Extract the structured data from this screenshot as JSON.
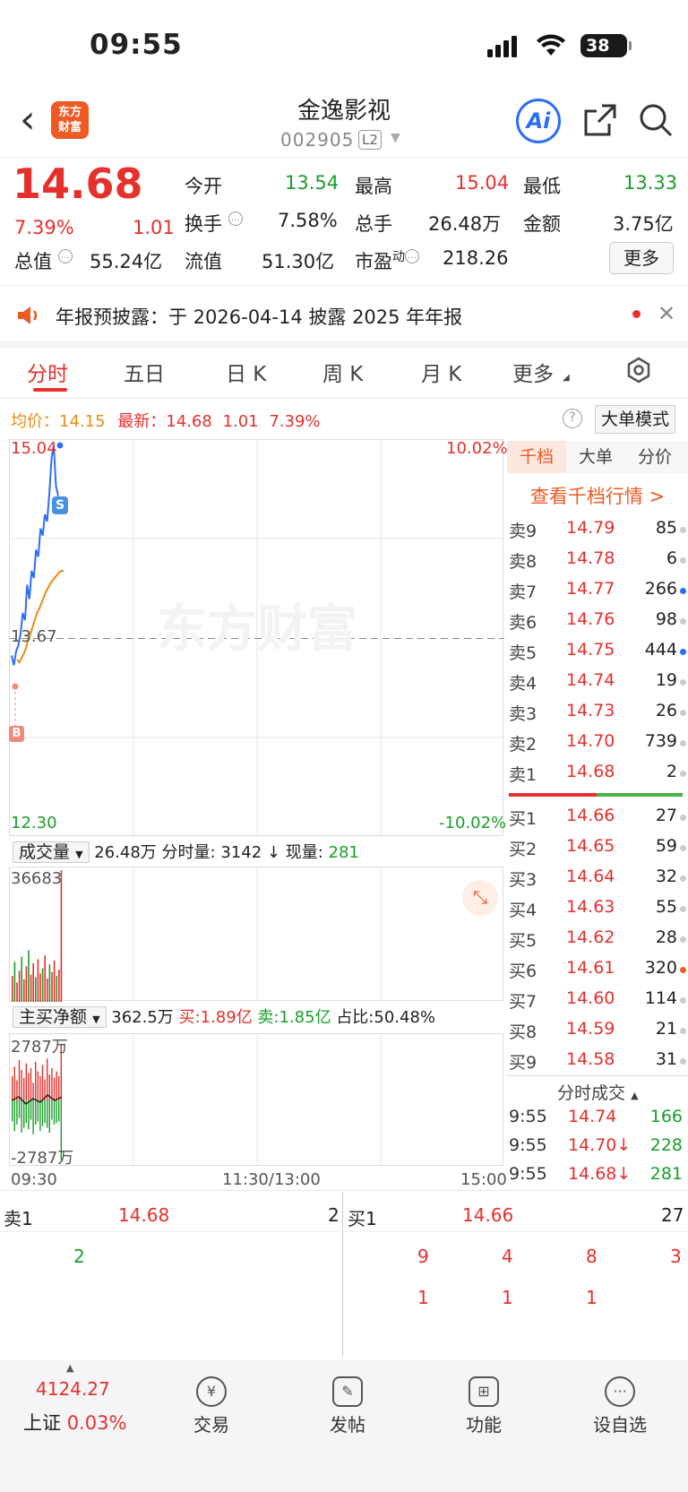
{
  "status_bar": {
    "time": "09:55",
    "battery": "38"
  },
  "header": {
    "logo_text": "东方财富",
    "stock_name": "金逸影视",
    "stock_code": "002905",
    "level": "L2",
    "ai_label": "Ai"
  },
  "quote": {
    "price": "14.68",
    "change_pct": "7.39%",
    "change": "1.01",
    "open_label": "今开",
    "open": "13.54",
    "high_label": "最高",
    "high": "15.04",
    "low_label": "最低",
    "low": "13.33",
    "turnover_label": "换手",
    "turnover": "7.58%",
    "total_hands_label": "总手",
    "total_hands": "26.48万",
    "amount_label": "金额",
    "amount": "3.75亿",
    "mktcap_label": "总值",
    "mktcap": "55.24亿",
    "float_label": "流值",
    "float": "51.30亿",
    "pe_label": "市盈",
    "pe_sup": "动",
    "pe": "218.26",
    "more_label": "更多"
  },
  "notice": {
    "text": "年报预披露：于 2026-04-14 披露 2025 年年报"
  },
  "tabs": [
    "分时",
    "五日",
    "日 K",
    "周 K",
    "月 K",
    "更多"
  ],
  "chart_header": {
    "avg_label": "均价：",
    "avg": "14.15",
    "latest_label": "最新：",
    "latest": "14.68",
    "chg": "1.01",
    "pct": "7.39%",
    "big_mode": "大单模式"
  },
  "chart_data": {
    "type": "line",
    "y_top": "15.04",
    "y_mid": "13.67",
    "y_bottom": "12.30",
    "pct_top": "10.02%",
    "pct_bottom": "-10.02%",
    "x_labels": [
      "09:30",
      "11:30/13:00",
      "15:00"
    ],
    "series": [
      {
        "values": [
          13.55,
          13.48,
          13.58,
          13.62,
          13.7,
          13.85,
          13.8,
          14.05,
          13.95,
          14.15,
          14.1,
          14.3,
          14.25,
          14.45,
          14.4,
          14.55,
          14.5,
          14.7,
          14.95,
          15.04,
          14.75,
          14.68
        ]
      },
      {
        "values": [
          13.52,
          13.5,
          13.53,
          13.56,
          13.6,
          13.66,
          13.7,
          13.75,
          13.8,
          13.85,
          13.88,
          13.92,
          13.96,
          14.0,
          14.03,
          14.06,
          14.08,
          14.1,
          14.12,
          14.14,
          14.15,
          14.15
        ]
      }
    ],
    "markers": [
      "S",
      "B"
    ],
    "watermark": "东方财富"
  },
  "volume": {
    "selector": "成交量",
    "total": "26.48万",
    "minute_label": "分时量:",
    "minute": "3142",
    "current_label": "现量:",
    "current": "281",
    "max": "36683"
  },
  "flow": {
    "selector": "主买净额",
    "net": "362.5万",
    "buy_label": "买:",
    "buy": "1.89亿",
    "sell_label": "卖:",
    "sell": "1.85亿",
    "ratio_label": "占比:",
    "ratio": "50.48%",
    "top": "2787万",
    "bottom": "-2787万"
  },
  "book_tabs": [
    "千档",
    "大单",
    "分价"
  ],
  "book_link": "查看千档行情 >",
  "asks": [
    {
      "label": "卖9",
      "price": "14.79",
      "vol": "85"
    },
    {
      "label": "卖8",
      "price": "14.78",
      "vol": "6"
    },
    {
      "label": "卖7",
      "price": "14.77",
      "vol": "266"
    },
    {
      "label": "卖6",
      "price": "14.76",
      "vol": "98"
    },
    {
      "label": "卖5",
      "price": "14.75",
      "vol": "444"
    },
    {
      "label": "卖4",
      "price": "14.74",
      "vol": "19"
    },
    {
      "label": "卖3",
      "price": "14.73",
      "vol": "26"
    },
    {
      "label": "卖2",
      "price": "14.70",
      "vol": "739"
    },
    {
      "label": "卖1",
      "price": "14.68",
      "vol": "2"
    }
  ],
  "bids": [
    {
      "label": "买1",
      "price": "14.66",
      "vol": "27"
    },
    {
      "label": "买2",
      "price": "14.65",
      "vol": "59"
    },
    {
      "label": "买3",
      "price": "14.64",
      "vol": "32"
    },
    {
      "label": "买4",
      "price": "14.63",
      "vol": "55"
    },
    {
      "label": "买5",
      "price": "14.62",
      "vol": "28"
    },
    {
      "label": "买6",
      "price": "14.61",
      "vol": "320"
    },
    {
      "label": "买7",
      "price": "14.60",
      "vol": "114"
    },
    {
      "label": "买8",
      "price": "14.59",
      "vol": "21"
    },
    {
      "label": "买9",
      "price": "14.58",
      "vol": "31"
    }
  ],
  "ticks_title": "分时成交",
  "ticks": [
    {
      "time": "9:55",
      "price": "14.74",
      "vol": "166"
    },
    {
      "time": "9:55",
      "price": "14.70↓",
      "vol": "228"
    },
    {
      "time": "9:55",
      "price": "14.68↓",
      "vol": "281"
    }
  ],
  "queue": {
    "ask_label": "卖1",
    "ask_price": "14.68",
    "ask_vol": "2",
    "ask_orders": [
      "2"
    ],
    "bid_label": "买1",
    "bid_price": "14.66",
    "bid_vol": "27",
    "bid_orders": [
      "9",
      "4",
      "8",
      "3",
      "1",
      "1",
      "1"
    ]
  },
  "bottom_bar": {
    "index_value": "4124.27",
    "index_name": "上证",
    "index_pct": "0.03%",
    "trade": "交易",
    "post": "发帖",
    "func": "功能",
    "watch": "设自选"
  },
  "colors": {
    "red": "#e5302c",
    "green": "#1a9e2a",
    "blue": "#2d6df6",
    "orange": "#ef8a12"
  }
}
